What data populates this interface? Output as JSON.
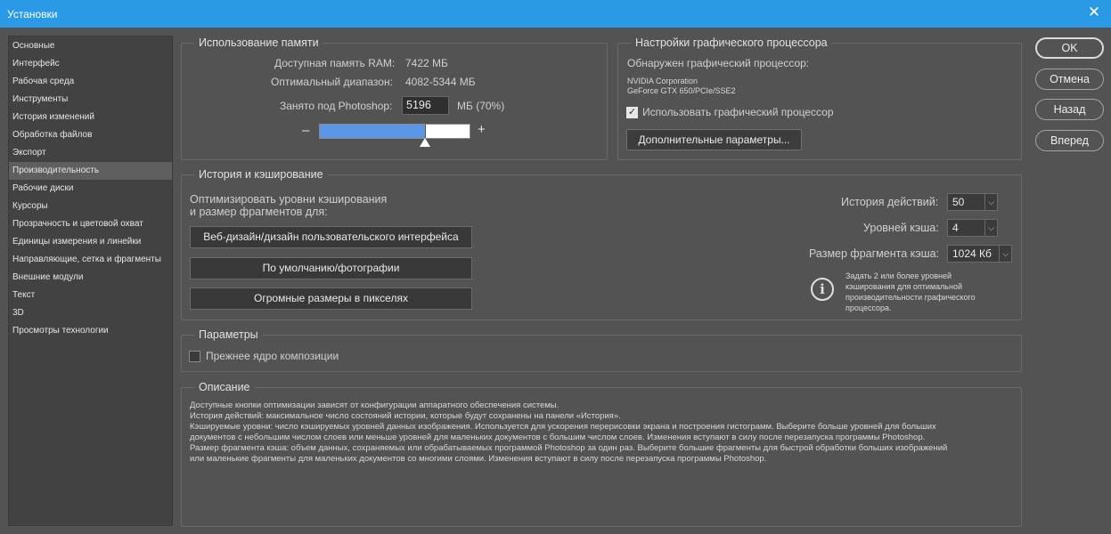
{
  "window": {
    "title": "Установки"
  },
  "sidebar": {
    "items": [
      {
        "label": "Основные"
      },
      {
        "label": "Интерфейс"
      },
      {
        "label": "Рабочая среда"
      },
      {
        "label": "Инструменты"
      },
      {
        "label": "История изменений"
      },
      {
        "label": "Обработка файлов"
      },
      {
        "label": "Экспорт"
      },
      {
        "label": "Производительность"
      },
      {
        "label": "Рабочие диски"
      },
      {
        "label": "Курсоры"
      },
      {
        "label": "Прозрачность и цветовой охват"
      },
      {
        "label": "Единицы измерения и линейки"
      },
      {
        "label": "Направляющие, сетка и фрагменты"
      },
      {
        "label": "Внешние модули"
      },
      {
        "label": "Текст"
      },
      {
        "label": "3D"
      },
      {
        "label": "Просмотры технологии"
      }
    ],
    "selected": "Производительность"
  },
  "memory": {
    "title": "Использование памяти",
    "available_label": "Доступная память RAM:",
    "available_value": "7422 МБ",
    "optimal_label": "Оптимальный диапазон:",
    "optimal_value": "4082-5344 МБ",
    "used_label": "Занято под Photoshop:",
    "used_value": "5196",
    "used_suffix": "МБ (70%)",
    "minus": "–",
    "plus": "+",
    "slider_fraction": 0.7
  },
  "gpu": {
    "title": "Настройки графического процессора",
    "detected_label": "Обнаружен графический процессор:",
    "vendor": "NVIDIA Corporation",
    "model": "GeForce GTX 650/PCIe/SSE2",
    "use_gpu_label": "Использовать графический процессор",
    "use_gpu_checked": true,
    "advanced_button": "Дополнительные параметры..."
  },
  "cache": {
    "title": "История и кэширование",
    "optimize_line1": "Оптимизировать уровни кэширования",
    "optimize_line2": "и размер фрагментов для:",
    "buttons": [
      "Веб-дизайн/дизайн пользовательского интерфейса",
      "По умолчанию/фотографии",
      "Огромные размеры в пикселях"
    ],
    "history_label": "История действий:",
    "history_value": "50",
    "levels_label": "Уровней кэша:",
    "levels_value": "4",
    "tile_label": "Размер фрагмента кэша:",
    "tile_value": "1024 Кб",
    "hint_lines": [
      "Задать 2 или более уровней",
      "кэширования для оптимальной",
      "производительности графического",
      "процессора."
    ]
  },
  "params": {
    "title": "Параметры",
    "legacy_label": "Прежнее ядро композиции",
    "legacy_checked": false
  },
  "description": {
    "title": "Описание",
    "lines": [
      "Доступные кнопки оптимизации зависят от конфигурации аппаратного обеспечения системы.",
      "История действий: максимальное число состояний истории, которые будут сохранены на панели «История».",
      "Кэшируемые уровни: число кэшируемых уровней данных изображения. Используется для ускорения перерисовки экрана и построения гистограмм. Выберите больше уровней для больших",
      "документов с небольшим числом слоев или меньше уровней для маленьких документов с большим числом слоев. Изменения вступают в силу после перезапуска программы Photoshop.",
      "Размер фрагмента кэша: объем данных, сохраняемых или обрабатываемых программой Photoshop за один раз. Выберите большие фрагменты для быстрой обработки больших изображений",
      "или маленькие фрагменты для маленьких документов со многими слоями. Изменения вступают в силу после перезапуска программы Photoshop."
    ]
  },
  "actions": {
    "ok": "OK",
    "cancel": "Отмена",
    "back": "Назад",
    "forward": "Вперед"
  },
  "colors": {
    "titlebar": "#2b9ae6",
    "panel": "#535353",
    "sidebar": "#424242",
    "slider_fill": "#5b97e6"
  }
}
